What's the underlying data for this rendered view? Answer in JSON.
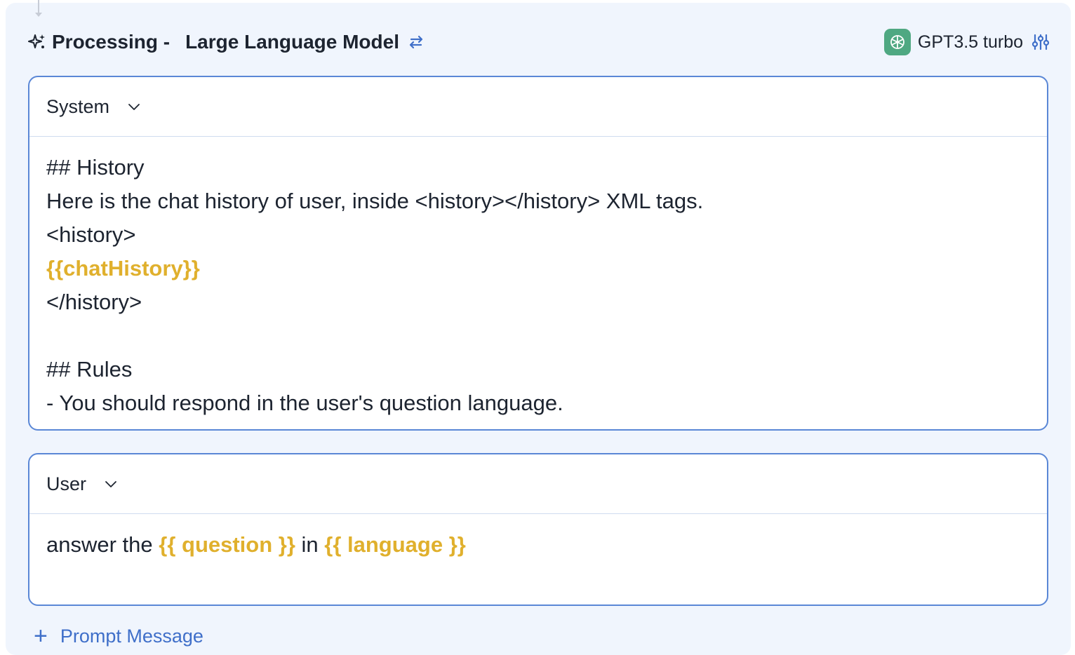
{
  "header": {
    "title": "Processing -",
    "model_label": "Large Language Model"
  },
  "model_picker": {
    "name": "GPT3.5 turbo",
    "icon": "openai-logo-icon",
    "accent": "#4fa882"
  },
  "colors": {
    "accent": "#3f6fc9",
    "variable": "#e0b02d",
    "panel_bg": "#f0f5fd"
  },
  "messages": [
    {
      "role": "System",
      "lines": [
        {
          "text": "## History"
        },
        {
          "text": "Here is the chat history of user, inside <history></history> XML tags."
        },
        {
          "text": "<history>"
        },
        {
          "var": "{{chatHistory}}"
        },
        {
          "text": "</history>"
        },
        {
          "text": ""
        },
        {
          "text": "## Rules"
        },
        {
          "text": "- You should respond in the user's question language."
        }
      ]
    },
    {
      "role": "User",
      "segments": [
        {
          "text": "answer the "
        },
        {
          "var": "{{ question }}"
        },
        {
          "text": " in "
        },
        {
          "var": "{{ language }}"
        }
      ]
    }
  ],
  "add_message": {
    "label": "Prompt Message"
  }
}
